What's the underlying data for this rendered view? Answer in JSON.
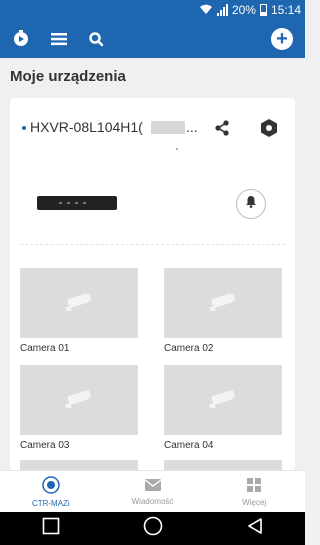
{
  "status_bar": {
    "battery": "20%",
    "time": "15:14"
  },
  "header": {
    "add_icon": "plus-icon"
  },
  "page": {
    "title": "Moje urządzenia"
  },
  "device": {
    "name": "HXVR-08L104H1(",
    "ellipsis": "...",
    "cameras": [
      {
        "label": "Camera 01"
      },
      {
        "label": "Camera 02"
      },
      {
        "label": "Camera 03"
      },
      {
        "label": "Camera 04"
      }
    ]
  },
  "bottom_nav": {
    "items": [
      {
        "label": "CTR-MAZi",
        "icon": "home-icon",
        "active": true
      },
      {
        "label": "Wiadomość",
        "icon": "envelope-icon",
        "active": false
      },
      {
        "label": "Więcej",
        "icon": "grid-icon",
        "active": false
      }
    ]
  },
  "colors": {
    "primary": "#1e67b0",
    "thumb": "#dcdcdc"
  }
}
